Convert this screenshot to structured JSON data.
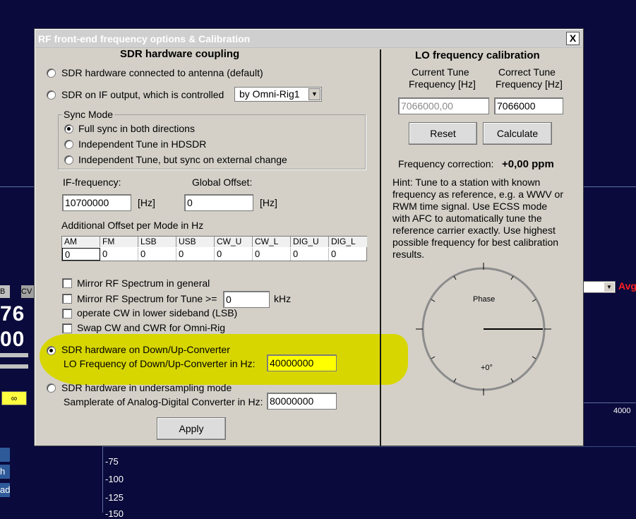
{
  "background": {
    "y_labels": [
      "-75",
      "-100",
      "-125",
      "-150"
    ],
    "x_label": "4000",
    "big_digits": [
      "76",
      "00"
    ],
    "side_buttons": [
      "h",
      "ad"
    ],
    "avg_label": "Avg",
    "mini_label_a": "B",
    "mini_label_b": "CV"
  },
  "dialog": {
    "title": "RF front-end frequency options & Calibration",
    "close_label": "X",
    "left": {
      "title": "SDR hardware coupling",
      "radio_antenna": "SDR hardware connected to antenna (default)",
      "radio_if": "SDR on IF output, which is controlled",
      "if_control_select": "by Omni-Rig1",
      "sync_mode": {
        "legend": "Sync Mode",
        "options": [
          "Full sync in both directions",
          "Independent Tune in HDSDR",
          "Independent Tune, but sync on external change"
        ]
      },
      "if_frequency_label": "IF-frequency:",
      "if_frequency_value": "10700000",
      "hz_unit_1": "[Hz]",
      "global_offset_label": "Global Offset:",
      "global_offset_value": "0",
      "hz_unit_2": "[Hz]",
      "additional_offset_label": "Additional Offset per Mode in Hz",
      "offset_columns": [
        "AM",
        "FM",
        "LSB",
        "USB",
        "CW_U",
        "CW_L",
        "DIG_U",
        "DIG_L"
      ],
      "offset_values": [
        "0",
        "0",
        "0",
        "0",
        "0",
        "0",
        "0",
        "0"
      ],
      "checks": {
        "mirror_general": "Mirror RF Spectrum in general",
        "mirror_tune": "Mirror RF Spectrum for Tune >=",
        "mirror_tune_value": "0",
        "khz_unit": "kHz",
        "cw_lsb": "operate CW in lower sideband (LSB)",
        "swap_cw": "Swap CW and CWR for Omni-Rig"
      },
      "radio_converter": "SDR hardware on Down/Up-Converter",
      "lo_freq_label": "LO Frequency of  Down/Up-Converter in Hz:",
      "lo_freq_value": "40000000",
      "radio_undersampling": "SDR hardware in undersampling mode",
      "samplerate_label": "Samplerate of Analog-Digital Converter in Hz:",
      "samplerate_value": "80000000",
      "apply_label": "Apply"
    },
    "right": {
      "title": "LO frequency calibration",
      "current_tune_label_1": "Current Tune",
      "current_tune_label_2": "Frequency [Hz]",
      "correct_tune_label_1": "Correct Tune",
      "correct_tune_label_2": "Frequency [Hz]",
      "current_tune_value": "7066000,00",
      "correct_tune_value": "7066000",
      "reset_label": "Reset",
      "calculate_label": "Calculate",
      "freq_correction_label": "Frequency correction:",
      "freq_correction_value": "+0,00 ppm",
      "hint": "Hint: Tune to a station with known frequency as reference, e.g. a WWV or RWM time signal. Use ECSS mode with AFC to automatically tune the reference carrier exactly. Use highest possible frequency for best calibration results.",
      "phase_label": "Phase",
      "phase_value": "+0°"
    }
  },
  "colors": {
    "highlight": "#d7d600",
    "lo_input_bg": "#ffff00",
    "background": "#0a0a3c"
  }
}
